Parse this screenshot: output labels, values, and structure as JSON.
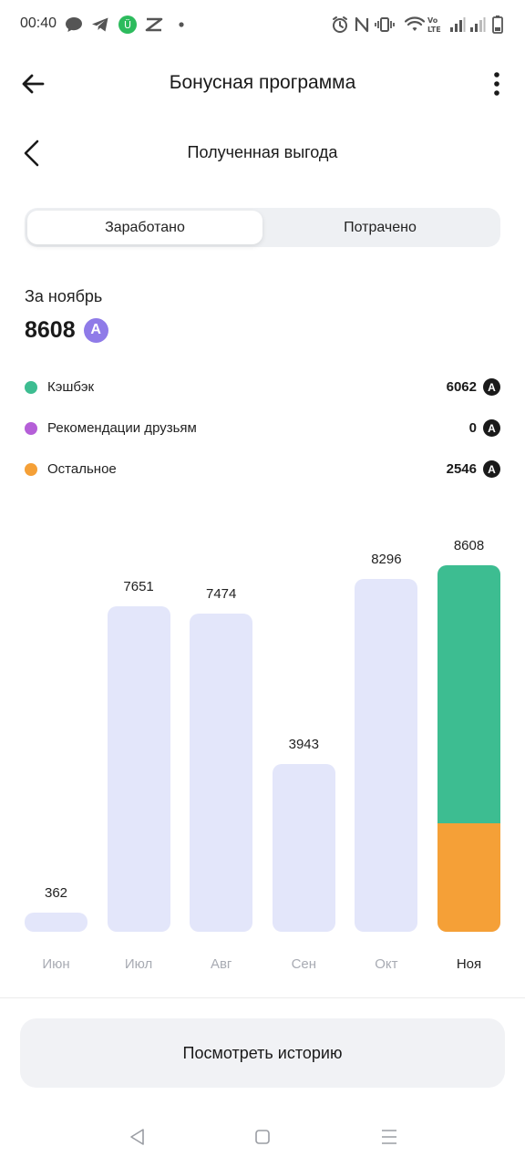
{
  "status_bar": {
    "time": "00:40",
    "icons": [
      "chat-bubble-icon",
      "telegram-icon",
      "app-green-icon",
      "capcut-icon",
      "dot-icon",
      "alarm-icon",
      "nfc-icon",
      "vibrate-icon",
      "wifi-icon",
      "volte-icon",
      "signal-icon",
      "signal-icon",
      "battery-icon"
    ]
  },
  "app_bar": {
    "title": "Бонусная программа",
    "back_icon": "arrow-left-icon",
    "menu_icon": "more-vertical-icon"
  },
  "sub_header": {
    "title": "Полученная выгода",
    "back_icon": "chevron-left-icon"
  },
  "segment": {
    "tabs": [
      {
        "label": "Заработано",
        "active": true
      },
      {
        "label": "Потрачено",
        "active": false
      }
    ]
  },
  "summary": {
    "period": "За ноябрь",
    "total": "8608",
    "badge": "A",
    "badge_color": "#8f7be8"
  },
  "breakdown": [
    {
      "label": "Кэшбэк",
      "value": "6062",
      "color": "#3dbd91",
      "badge": "A"
    },
    {
      "label": "Рекомендации друзьям",
      "value": "0",
      "color": "#b55fd8",
      "badge": "A"
    },
    {
      "label": "Остальное",
      "value": "2546",
      "color": "#f5a037",
      "badge": "A"
    }
  ],
  "chart_data": {
    "type": "bar",
    "categories": [
      "Июн",
      "Июл",
      "Авг",
      "Сен",
      "Окт",
      "Ноя"
    ],
    "values": [
      362,
      7651,
      7474,
      3943,
      8296,
      8608
    ],
    "value_labels": [
      "362",
      "7651",
      "7474",
      "3943",
      "8296",
      "8608"
    ],
    "highlighted": "Ноя",
    "highlight_breakdown": [
      {
        "value": 6062,
        "color": "#3dbd91"
      },
      {
        "value": 2546,
        "color": "#f5a037"
      }
    ],
    "colors": {
      "bar": "#e3e6fa",
      "month_inactive": "#a8abb3",
      "month_active": "#222222"
    }
  },
  "history_button": {
    "label": "Посмотреть историю"
  },
  "nav_bar": {
    "icons": [
      "nav-back-icon",
      "nav-home-icon",
      "nav-recents-icon"
    ]
  }
}
